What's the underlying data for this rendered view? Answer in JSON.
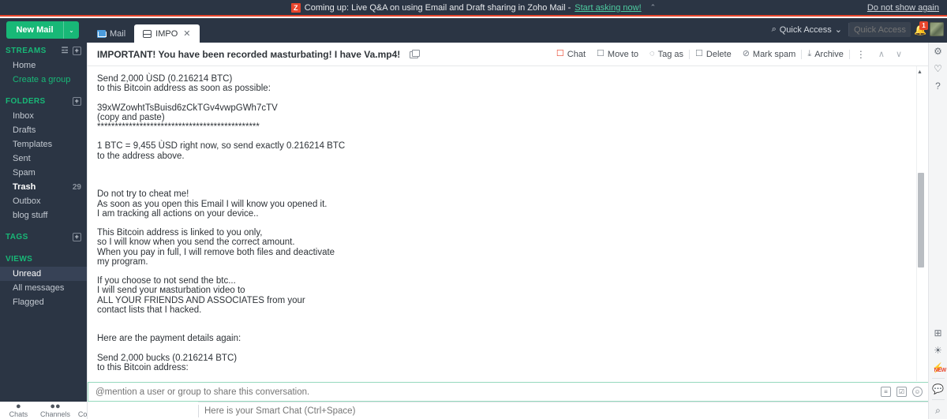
{
  "promo": {
    "logo": "Z",
    "text": "Coming up: Live Q&A on using Email and Draft sharing in Zoho Mail -",
    "link": "Start asking now!",
    "collapse_icon": "⌃",
    "dismiss": "Do not show again"
  },
  "topbar": {
    "new_mail": "New Mail",
    "new_mail_caret": "⌄",
    "quick_access_label": "Quick Access",
    "quick_access_caret": "⌄",
    "quick_access_placeholder": "Quick Access (/",
    "search_icon": "⌕",
    "bell_icon": "🔔",
    "bell_badge": "1"
  },
  "tabs": [
    {
      "label": "Mail",
      "active": false
    },
    {
      "label": "IMPO",
      "active": true,
      "close": "✕"
    }
  ],
  "sidebar": {
    "streams": {
      "title": "STREAMS",
      "settings_icon": "☲",
      "add_icon": "+",
      "items": [
        {
          "label": "Home",
          "style": ""
        },
        {
          "label": "Create a group",
          "style": "green"
        }
      ]
    },
    "folders": {
      "title": "FOLDERS",
      "add_icon": "+",
      "items": [
        {
          "label": "Inbox",
          "count": ""
        },
        {
          "label": "Drafts",
          "count": ""
        },
        {
          "label": "Templates",
          "count": ""
        },
        {
          "label": "Sent",
          "count": ""
        },
        {
          "label": "Spam",
          "count": ""
        },
        {
          "label": "Trash",
          "count": "29",
          "style": "bold"
        },
        {
          "label": "Outbox",
          "count": ""
        },
        {
          "label": "blog stuff",
          "count": ""
        }
      ]
    },
    "tags": {
      "title": "TAGS",
      "add_icon": "+"
    },
    "views": {
      "title": "VIEWS",
      "items": [
        {
          "label": "Unread",
          "style": "sel"
        },
        {
          "label": "All messages",
          "style": ""
        },
        {
          "label": "Flagged",
          "style": ""
        }
      ]
    }
  },
  "chat_strip": [
    {
      "label": "Chats",
      "icon": "●"
    },
    {
      "label": "Channels",
      "icon": "●●"
    },
    {
      "label": "Contacts",
      "icon": "●"
    }
  ],
  "mail": {
    "subject": "IMPORTANT! You have been recorded мasturbating! I have Va.mp4!",
    "actions": [
      {
        "label": "Chat",
        "icon": "☐",
        "accent": "red"
      },
      {
        "label": "Move to",
        "icon": "☐"
      },
      {
        "label": "Tag as",
        "icon": "◌"
      },
      {
        "label": "Delete",
        "icon": "☐"
      },
      {
        "label": "Mark spam",
        "icon": "⊘"
      },
      {
        "label": "Archive",
        "icon": "⤓"
      }
    ],
    "more_icon": "⋮",
    "prev_icon": "∧",
    "next_icon": "∨",
    "body": "Send 2,000 ÙSD (0.216214 BTC)\nto this Bitcoin address as soon as possible:\n\n39xWZowhtTsBuisd6zCkTGv4vwpGWh7cTV\n(copy and paste)\n**********************************************\n\n1 BTC = 9,455 ÙSD right now, so send exactly 0.216214 BTC\nto the address above.\n\n\n\nDo not try to cheat me!\nAs soon as you open this Email I will know you opened it.\nI am tracking all actions on your device..\n\nThis Bitcoin address is linked to you only,\nso I will know when you send the correct amount.\nWhen you pay in full, I will remove both files and deactivate\nmy program.\n\nIf you choose to not send the btc...\nI will send your мasturbation video to\nALL YOUR FRIENDS AND ASSOCIATES from your\ncontact lists that I hacked.\n\n\nHere are the payment details again:\n\nSend 2,000 bucks (0.216214 BTC)\nto this Bitcoin address:\n\n**********************************************"
  },
  "mention": {
    "placeholder": "@mention a user or group to share this conversation.",
    "icons": [
      "≡",
      "☑",
      "☺"
    ]
  },
  "smart_chat": {
    "placeholder": "Here is your Smart Chat (Ctrl+Space)"
  },
  "right_rail": {
    "top_icons": [
      {
        "name": "gear-icon",
        "glyph": "⚙"
      },
      {
        "name": "heart-icon",
        "glyph": "♡"
      },
      {
        "name": "help-icon",
        "glyph": "?"
      }
    ],
    "bottom_icons": [
      {
        "name": "add-note-icon",
        "glyph": "⊞"
      },
      {
        "name": "bulb-icon",
        "glyph": "☀"
      },
      {
        "name": "plug-icon",
        "glyph": "⚡"
      },
      {
        "name": "comment-icon",
        "glyph": "💬"
      },
      {
        "name": "search-icon",
        "glyph": "⌕"
      }
    ],
    "new_label": "NEW"
  },
  "scrollbar": {
    "up_arrow": "▲"
  },
  "colors": {
    "brand_green": "#18b877",
    "accent_red": "#e8452c",
    "chrome_dark": "#2b3544",
    "rail_bg": "#f4f5f6"
  }
}
